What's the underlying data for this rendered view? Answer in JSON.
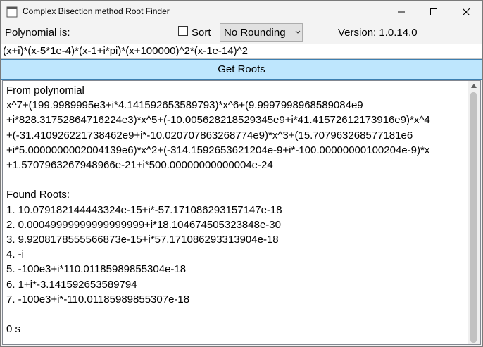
{
  "window": {
    "title": "Complex Bisection method Root Finder",
    "icons": {
      "app": "app-icon",
      "minimize": "minimize-icon",
      "maximize": "maximize-icon",
      "close": "close-icon"
    }
  },
  "toolbar": {
    "polynomial_label": "Polynomial is:",
    "sort_label": "Sort",
    "sort_checked": false,
    "rounding_value": "No Rounding",
    "version": "Version: 1.0.14.0"
  },
  "input": {
    "polynomial": "(x+i)*(x-5*1e-4)*(x-1+i*pi)*(x+100000)^2*(x-1e-14)^2"
  },
  "get_roots_label": "Get Roots",
  "output": {
    "lines": [
      "From polynomial",
      "x^7+(199.9989995e3+i*4.141592653589793)*x^6+(9.9997998968589084e9",
      "+i*828.31752864716224e3)*x^5+(-10.005628218529345e9+i*41.41572612173916e9)*x^4",
      "+(-31.410926221738462e9+i*-10.020707863268774e9)*x^3+(15.707963268577181e6",
      "+i*5.0000000002004139e6)*x^2+(-314.1592653621204e-9+i*-100.00000000100204e-9)*x",
      "+1.5707963267948966e-21+i*500.00000000000004e-24",
      "",
      "Found Roots:",
      "1. 10.079182144443324e-15+i*-57.171086293157147e-18",
      "2. 0.00049999999999999999+i*18.104674505323848e-30",
      "3. 9.9208178555566873e-15+i*57.171086293313904e-18",
      "4. -i",
      "5. -100e3+i*110.01185989855304e-18",
      "6. 1+i*-3.141592653589794",
      "7. -100e3+i*-110.01185989855307e-18",
      "",
      "0 s"
    ]
  },
  "colors": {
    "button_bg": "#bee6fd",
    "button_border": "#3c7fb1",
    "window_bg": "#f3f3f3"
  }
}
